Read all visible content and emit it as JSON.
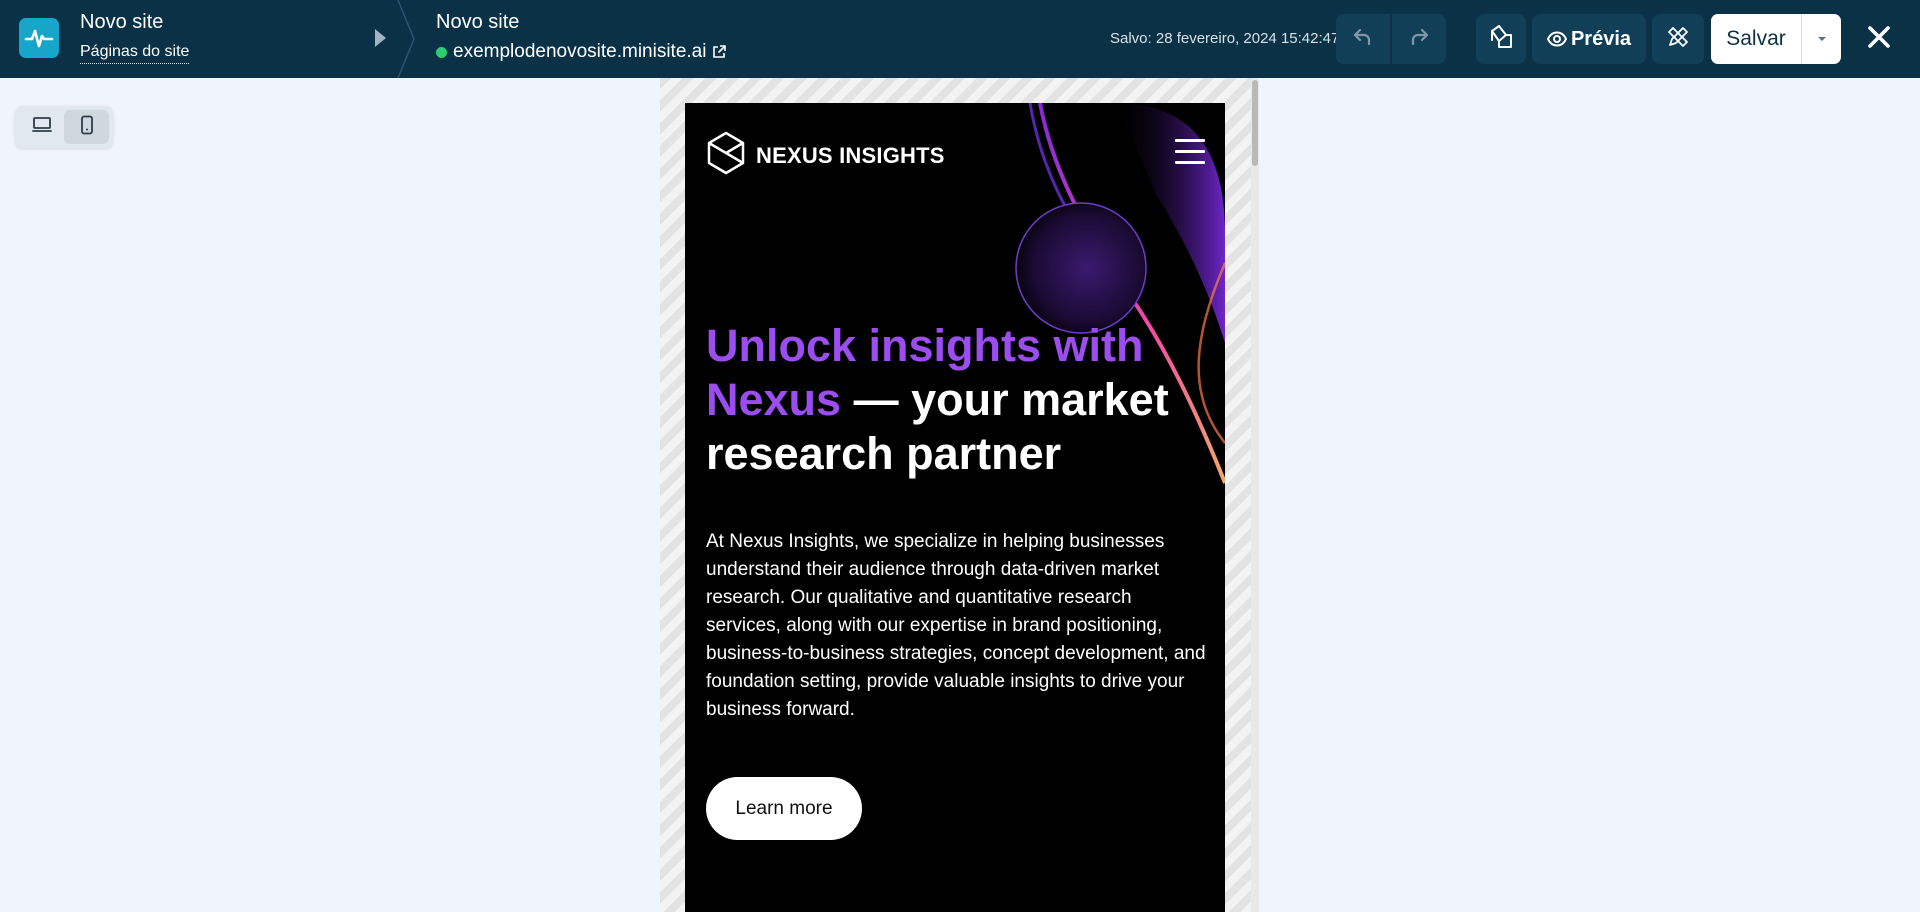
{
  "topbar": {
    "site_name": "Novo site",
    "site_pages_link": "Páginas do site",
    "page_name": "Novo site",
    "page_url": "exemplodenovosite.minisite.ai",
    "saved_status": "Salvo: 28 fevereiro, 2024 15:42:47",
    "preview_label": "Prévia",
    "save_label": "Salvar"
  },
  "icons": {
    "app_logo": "pulse-icon",
    "undo": "undo-icon",
    "redo": "redo-icon",
    "theme": "paint-bucket-icon",
    "preview": "eye-icon",
    "design": "pencil-ruler-icon",
    "save_dropdown": "caret-down-icon",
    "close": "close-icon",
    "external": "external-link-icon",
    "desktop": "desktop-icon",
    "mobile": "mobile-icon",
    "brand_logo": "cube-icon",
    "menu": "hamburger-icon"
  },
  "colors": {
    "topbar_bg": "#0b3147",
    "logo_bg": "#17a6c9",
    "accent_purple": "#9b4df0",
    "status_green": "#2ecc71"
  },
  "device_toggle": {
    "selected": "mobile"
  },
  "preview_site": {
    "brand_name": "NEXUS INSIGHTS",
    "headline_accent": "Unlock insights with Nexus",
    "headline_rest": " — your market research partner",
    "body": "At Nexus Insights, we specialize in helping businesses understand their audience through data-driven market research. Our qualitative and quantitative research services, along with our expertise in brand positioning, business-to-business strategies, concept development, and foundation setting, provide valuable insights to drive your business forward.",
    "cta_label": "Learn more"
  }
}
